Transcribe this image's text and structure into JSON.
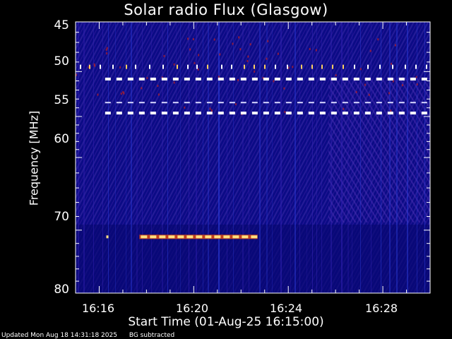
{
  "chart_data": {
    "type": "heatmap",
    "title": "Solar radio Flux (Glasgow)",
    "ylabel": "Frequency [MHz]",
    "xlabel": "Start Time (01-Aug-25 16:15:00)",
    "ylim": [
      80,
      45
    ],
    "y_scale": "log",
    "y_ticks": [
      "45",
      "50",
      "55",
      "60",
      "70",
      "80"
    ],
    "x_ticks": [
      "16:16",
      "16:20",
      "16:24",
      "16:28"
    ],
    "colors": {
      "background": "#0a0a80",
      "band_hot": "#ffffff",
      "band_warm": "#ffe080",
      "noise": "#c02020",
      "axis": "#ffffff"
    },
    "features": [
      {
        "name": "interference-line",
        "freq_mhz": 50.8,
        "minute_from": 16.25,
        "minute_to": 30.0,
        "intensity": "hot"
      },
      {
        "name": "interference-line",
        "freq_mhz": 54.6,
        "minute_from": 16.25,
        "minute_to": 30.0,
        "intensity": "hot"
      },
      {
        "name": "interference-line",
        "freq_mhz": 53.4,
        "minute_from": 16.25,
        "minute_to": 30.0,
        "intensity": "faint"
      },
      {
        "name": "interference-line",
        "freq_mhz": 71.0,
        "minute_from": 17.7,
        "minute_to": 22.7,
        "intensity": "warm"
      }
    ]
  },
  "footer": {
    "updated": "Updated Mon Aug 18 14:31:18 2025",
    "note": "BG subtracted"
  }
}
